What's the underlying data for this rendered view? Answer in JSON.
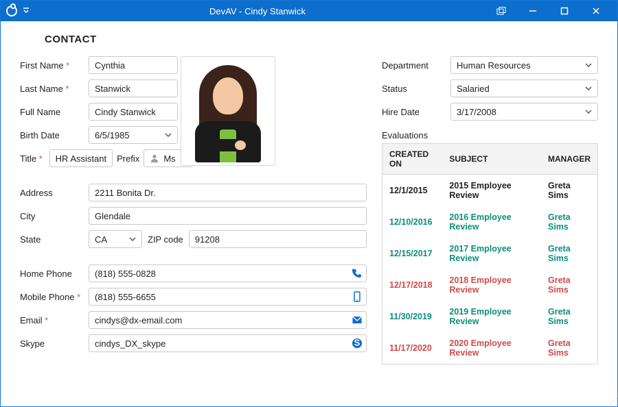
{
  "window": {
    "title": "DevAV - Cindy Stanwick"
  },
  "section": "CONTACT",
  "labels": {
    "first_name": "First Name",
    "last_name": "Last Name",
    "full_name": "Full Name",
    "birth_date": "Birth Date",
    "title": "Title",
    "prefix": "Prefix",
    "address": "Address",
    "city": "City",
    "state": "State",
    "zip": "ZIP code",
    "home_phone": "Home Phone",
    "mobile_phone": "Mobile Phone",
    "email": "Email",
    "skype": "Skype",
    "department": "Department",
    "status": "Status",
    "hire_date": "Hire Date",
    "evaluations": "Evaluations"
  },
  "values": {
    "first_name": "Cynthia",
    "last_name": "Stanwick",
    "full_name": "Cindy Stanwick",
    "birth_date": "6/5/1985",
    "title": "HR Assistant",
    "prefix": "Ms",
    "address": "2211 Bonita Dr.",
    "city": "Glendale",
    "state": "CA",
    "zip": "91208",
    "home_phone": "(818) 555-0828",
    "mobile_phone": "(818) 555-6655",
    "email": "cindys@dx-email.com",
    "skype": "cindys_DX_skype",
    "department": "Human Resources",
    "status": "Salaried",
    "hire_date": "3/17/2008"
  },
  "evals": {
    "headers": {
      "created": "CREATED ON",
      "subject": "SUBJECT",
      "manager": "MANAGER"
    },
    "rows": [
      {
        "date": "12/1/2015",
        "subject": "2015 Employee Review",
        "manager": "Greta Sims",
        "tone": "neutral"
      },
      {
        "date": "12/10/2016",
        "subject": "2016 Employee Review",
        "manager": "Greta Sims",
        "tone": "green"
      },
      {
        "date": "12/15/2017",
        "subject": "2017 Employee Review",
        "manager": "Greta Sims",
        "tone": "green"
      },
      {
        "date": "12/17/2018",
        "subject": "2018 Employee Review",
        "manager": "Greta Sims",
        "tone": "red"
      },
      {
        "date": "11/30/2019",
        "subject": "2019 Employee Review",
        "manager": "Greta Sims",
        "tone": "green"
      },
      {
        "date": "11/17/2020",
        "subject": "2020 Employee Review",
        "manager": "Greta Sims",
        "tone": "red"
      }
    ]
  }
}
